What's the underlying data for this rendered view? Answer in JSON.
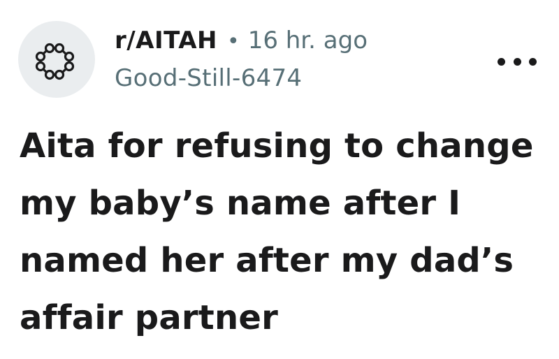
{
  "post": {
    "subreddit": "r/AITAH",
    "separator": "•",
    "time": "16 hr. ago",
    "author": "Good-Still-6474",
    "title": "Aita for refusing to change my baby’s name after I named her after my dad’s affair partner"
  },
  "icons": {
    "avatar": "community-nodes-icon",
    "more": "overflow-menu-icon"
  },
  "colors": {
    "text": "#1a1a1b",
    "muted": "#576f76",
    "avatar_bg": "#eaedef",
    "background": "#ffffff"
  }
}
